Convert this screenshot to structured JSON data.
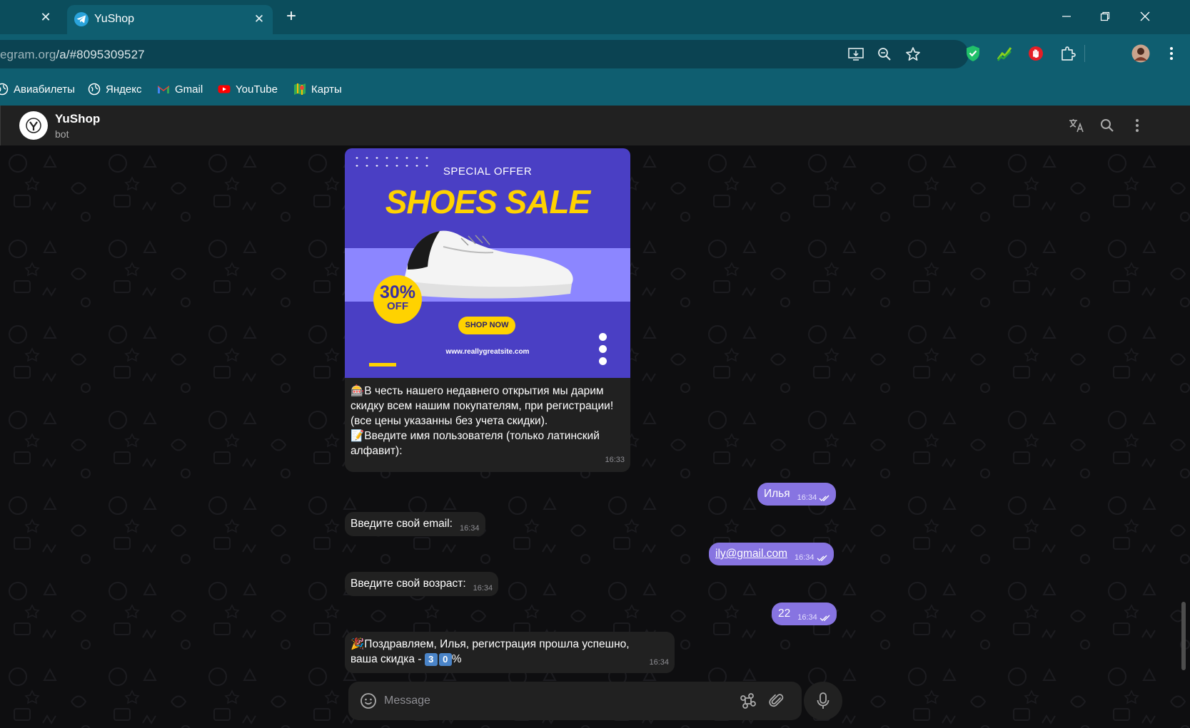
{
  "browser": {
    "tabs": [
      {
        "label": ""
      },
      {
        "label": "YuShop"
      }
    ],
    "url_dim": "egram.org",
    "url_rest": "/a/#8095309527",
    "bookmarks": [
      {
        "label": "Авиабилеты",
        "icon": "globe-icon"
      },
      {
        "label": "Яндекс",
        "icon": "globe-icon"
      },
      {
        "label": "Gmail",
        "icon": "gmail-icon"
      },
      {
        "label": "YouTube",
        "icon": "youtube-icon"
      },
      {
        "label": "Карты",
        "icon": "maps-icon"
      }
    ]
  },
  "chat": {
    "name": "YuShop",
    "subtitle": "bot",
    "ad": {
      "special": "SPECIAL OFFER",
      "title": "SHOES SALE",
      "badge_pct": "30%",
      "badge_off": "OFF",
      "cta": "SHOP NOW",
      "site": "www.reallygreatsite.com"
    },
    "messages": [
      {
        "dir": "in",
        "text1": "🎰В честь нашего недавнего открытия мы дарим скидку всем нашим покупателям, при регистрации!(все цены указанны без учета скидки).",
        "text2": "📝Введите имя пользователя (только латинский алфавит):",
        "time": "16:33"
      },
      {
        "dir": "out",
        "text": "Илья",
        "time": "16:34"
      },
      {
        "dir": "in",
        "text": "Введите свой email:",
        "time": "16:34"
      },
      {
        "dir": "out",
        "text": "ily@gmail.com",
        "time": "16:34"
      },
      {
        "dir": "in",
        "text": "Введите свой возраст:",
        "time": "16:34"
      },
      {
        "dir": "out",
        "text": "22",
        "time": "16:34"
      },
      {
        "dir": "in",
        "text1": "🎉Поздравляем, Илья, регистрация прошла успешно,",
        "text2_prefix": "ваша скидка - ",
        "text2_digits": [
          "3",
          "0"
        ],
        "text2_suffix": "%",
        "time": "16:34"
      }
    ],
    "composer_placeholder": "Message"
  },
  "colors": {
    "chrome_dark": "#0b4d5c",
    "chrome": "#0f5e70",
    "tg_panel": "#212121",
    "tg_accent": "#8774e1",
    "ad_blue": "#4a3fc4",
    "ad_yellow": "#ffd200"
  }
}
